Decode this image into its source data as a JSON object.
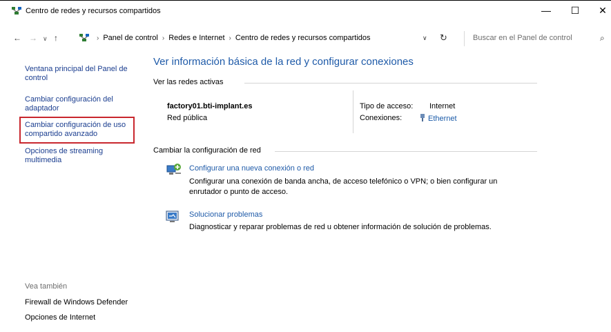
{
  "window": {
    "title": "Centro de redes y recursos compartidos",
    "controls": {
      "minimize": "—",
      "maximize": "☐",
      "close": "✕"
    }
  },
  "address_bar": {
    "back": "←",
    "forward": "→",
    "recent": "∨",
    "up": "↑",
    "breadcrumb": [
      "Panel de control",
      "Redes e Internet",
      "Centro de redes y recursos compartidos"
    ],
    "separator": "›",
    "dropdown": "∨",
    "refresh": "↻",
    "search_placeholder": "Buscar en el Panel de control",
    "search_icon": "⌕"
  },
  "sidebar": {
    "links": [
      "Ventana principal del Panel de control",
      "Cambiar configuración del adaptador",
      "Cambiar configuración de uso compartido avanzado",
      "Opciones de streaming multimedia"
    ],
    "see_also_title": "Vea también",
    "see_also": [
      "Firewall de Windows Defender",
      "Opciones de Internet"
    ]
  },
  "main": {
    "heading": "Ver información básica de la red y configurar conexiones",
    "active_networks_label": "Ver las redes activas",
    "network": {
      "name": "factory01.bti-implant.es",
      "type": "Red pública",
      "access_type_label": "Tipo de acceso:",
      "access_type_value": "Internet",
      "connections_label": "Conexiones:",
      "connection_value": "Ethernet"
    },
    "change_settings_label": "Cambiar la configuración de red",
    "tasks": [
      {
        "title": "Configurar una nueva conexión o red",
        "description": "Configurar una conexión de banda ancha, de acceso telefónico o VPN; o bien configurar un enrutador o punto de acceso."
      },
      {
        "title": "Solucionar problemas",
        "description": "Diagnosticar y reparar problemas de red u obtener información de solución de problemas."
      }
    ]
  },
  "colors": {
    "link": "#1a3d8f",
    "heading": "#1e5aa8",
    "highlight": "#c8262d"
  }
}
